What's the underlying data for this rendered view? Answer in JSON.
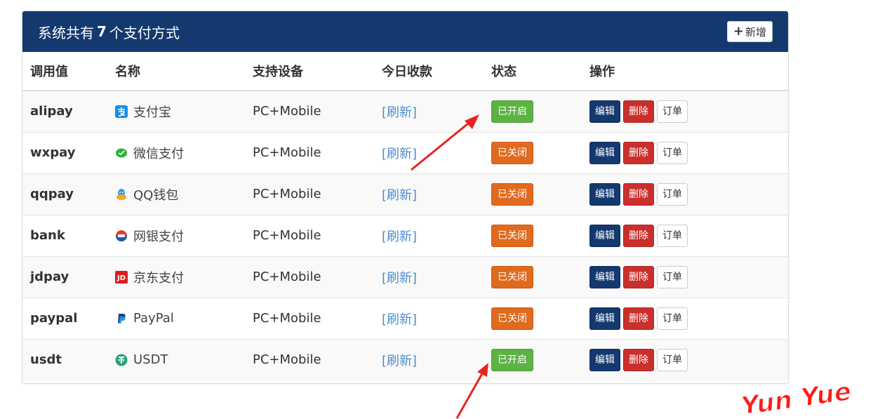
{
  "header": {
    "title_prefix": "系统共有",
    "count": "7",
    "title_suffix": "个支付方式",
    "add_label": "新增"
  },
  "columns": [
    "调用值",
    "名称",
    "支持设备",
    "今日收款",
    "状态",
    "操作"
  ],
  "actions": {
    "edit": "编辑",
    "delete": "删除",
    "orders": "订单"
  },
  "rows": [
    {
      "code": "alipay",
      "name": "支付宝",
      "icon": "alipay-icon",
      "device": "PC+Mobile",
      "income": "[刷新]",
      "status": "已开启",
      "enabled": true
    },
    {
      "code": "wxpay",
      "name": "微信支付",
      "icon": "wechat-pay-icon",
      "device": "PC+Mobile",
      "income": "[刷新]",
      "status": "已关闭",
      "enabled": false
    },
    {
      "code": "qqpay",
      "name": "QQ钱包",
      "icon": "qq-wallet-icon",
      "device": "PC+Mobile",
      "income": "[刷新]",
      "status": "已关闭",
      "enabled": false
    },
    {
      "code": "bank",
      "name": "网银支付",
      "icon": "bank-icon",
      "device": "PC+Mobile",
      "income": "[刷新]",
      "status": "已关闭",
      "enabled": false
    },
    {
      "code": "jdpay",
      "name": "京东支付",
      "icon": "jdpay-icon",
      "device": "PC+Mobile",
      "income": "[刷新]",
      "status": "已关闭",
      "enabled": false
    },
    {
      "code": "paypal",
      "name": "PayPal",
      "icon": "paypal-icon",
      "device": "PC+Mobile",
      "income": "[刷新]",
      "status": "已关闭",
      "enabled": false
    },
    {
      "code": "usdt",
      "name": "USDT",
      "icon": "usdt-icon",
      "device": "PC+Mobile",
      "income": "[刷新]",
      "status": "已开启",
      "enabled": true
    }
  ],
  "watermark": "Yun Yue",
  "colors": {
    "header_bg": "#14396e",
    "enabled": "#5cb344",
    "disabled": "#e06a1e",
    "delete": "#c9302c",
    "link": "#4b8dd1",
    "annotation": "#e8241e"
  }
}
